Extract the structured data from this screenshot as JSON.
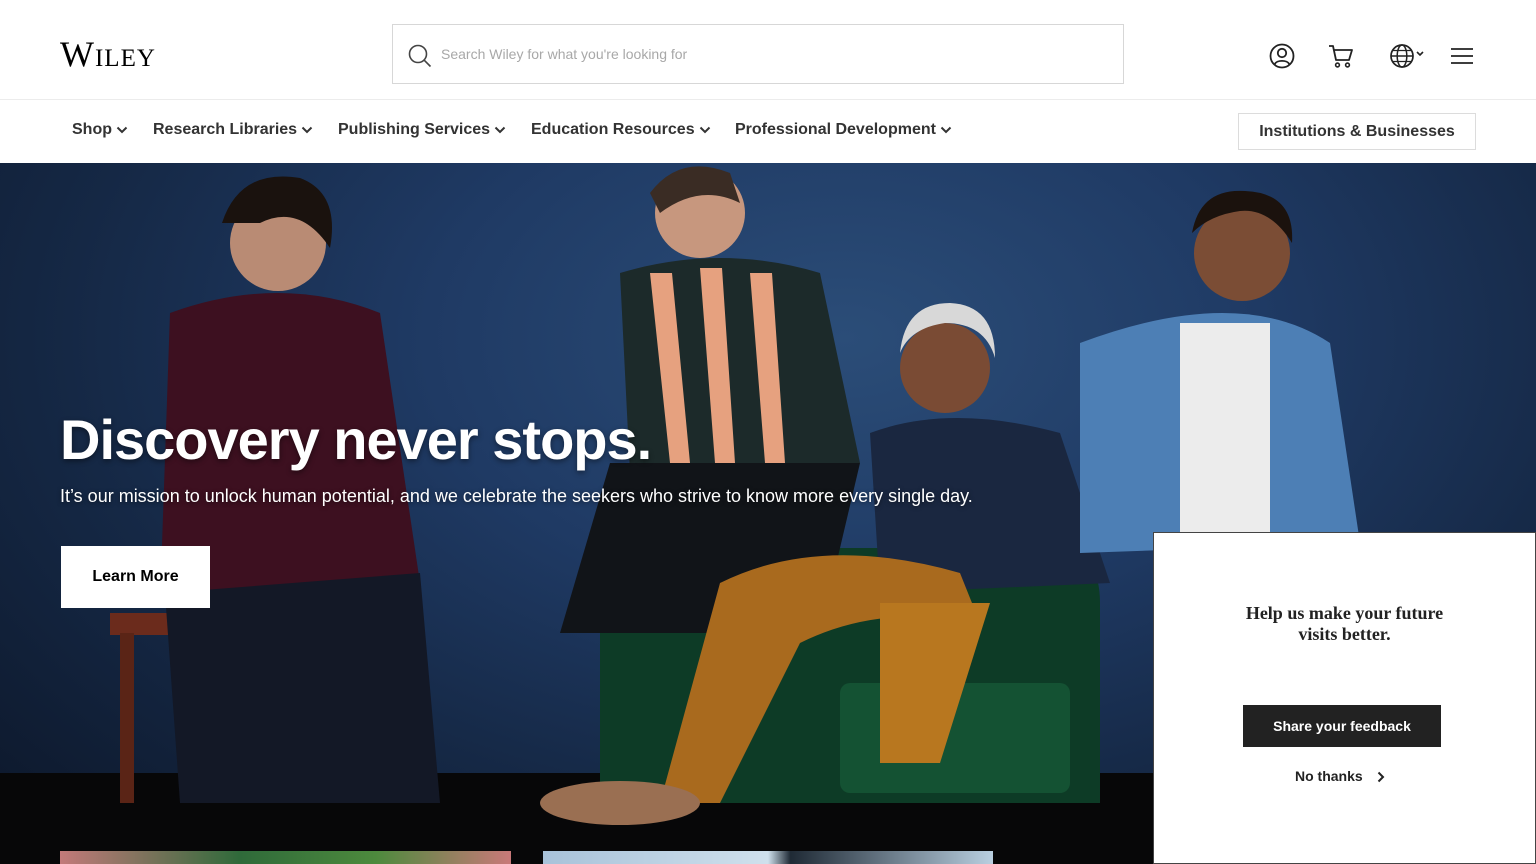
{
  "header": {
    "logo": "Wiley",
    "search_placeholder": "Search Wiley for what you're looking for",
    "icons": [
      "user-account-icon",
      "cart-icon",
      "globe-icon",
      "menu-icon"
    ]
  },
  "nav": {
    "items": [
      {
        "label": "Shop"
      },
      {
        "label": "Research Libraries"
      },
      {
        "label": "Publishing Services"
      },
      {
        "label": "Education Resources"
      },
      {
        "label": "Professional Development"
      }
    ],
    "institutions_label": "Institutions & Businesses"
  },
  "hero": {
    "title": "Discovery never stops.",
    "subtitle": "It’s our mission to unlock human potential, and we celebrate the seekers who strive to know more every single day.",
    "cta_label": "Learn More"
  },
  "feedback": {
    "title": "Help us make your future visits better.",
    "share_label": "Share your feedback",
    "dismiss_label": "No thanks"
  },
  "colors": {
    "hero_blue": "#1f3a64",
    "button_dark": "#222222",
    "text_dark": "#333333"
  }
}
